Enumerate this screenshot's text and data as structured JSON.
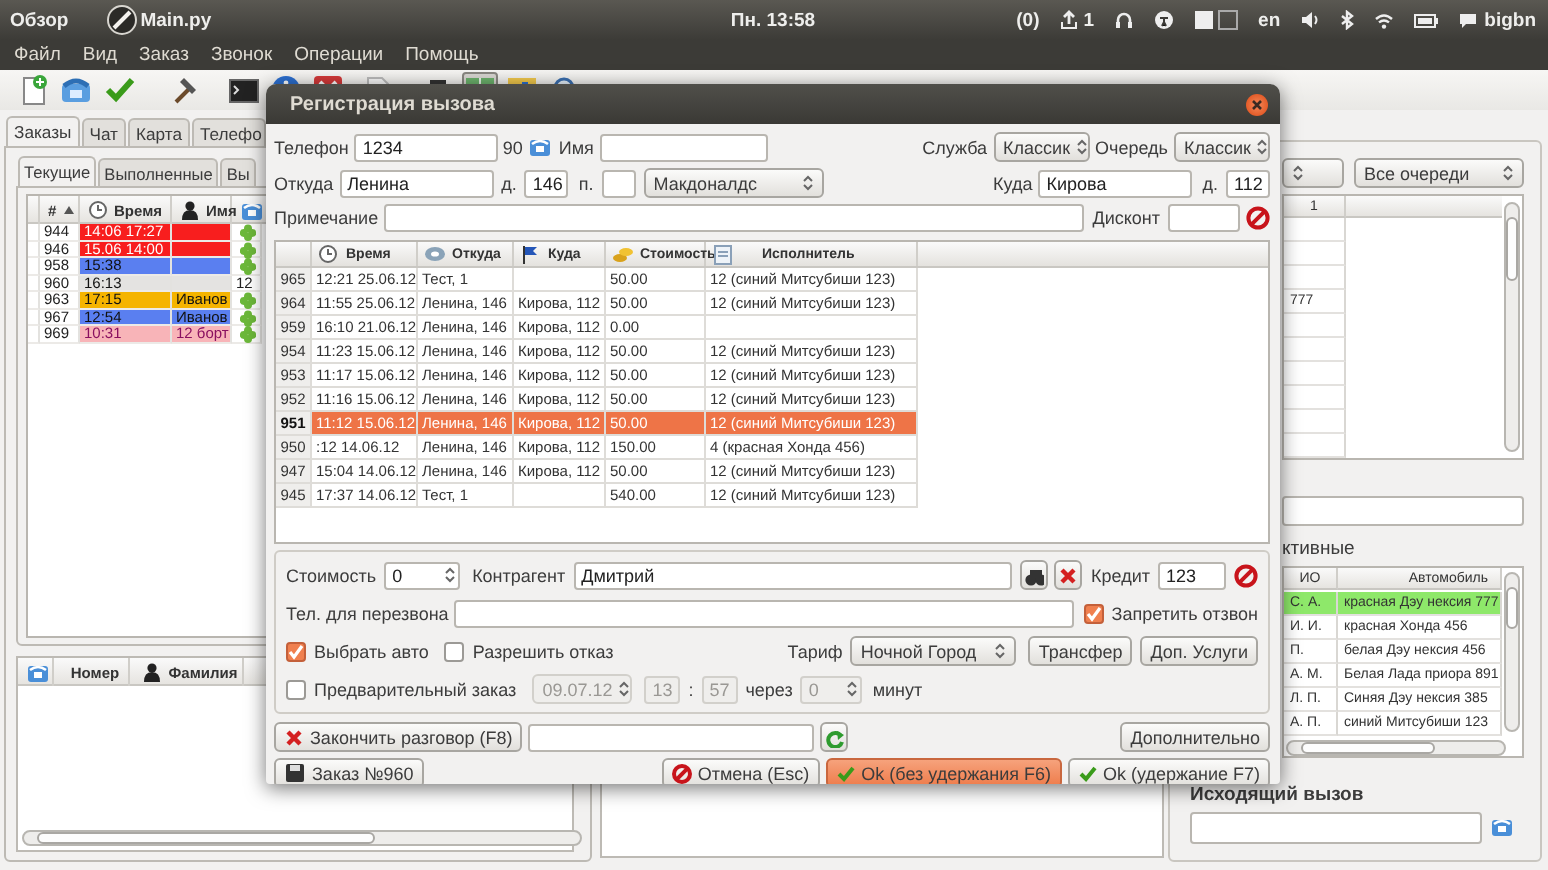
{
  "top_panel": {
    "activities": "Обзор",
    "window_title": "Main.py",
    "clock": "Пн. 13:58",
    "messages": "(0)",
    "updates": "1",
    "keyboard": "en",
    "user": "bigbn"
  },
  "menu": [
    "Файл",
    "Вид",
    "Заказ",
    "Звонок",
    "Операции",
    "Помощь"
  ],
  "toolbar": [
    {
      "selected": false
    },
    {
      "selected": false
    },
    {
      "selected": false
    },
    {
      "selected": false
    },
    {
      "selected": false
    },
    {
      "selected": false
    },
    {
      "selected": false
    },
    {
      "selected": false
    },
    {
      "selected": false
    },
    {
      "selected": true
    },
    {
      "selected": false
    },
    {
      "selected": false
    }
  ],
  "left_panel": {
    "tabs": [
      {
        "label": "Заказы",
        "selected": true
      },
      {
        "label": "Чат",
        "selected": false
      },
      {
        "label": "Карта",
        "selected": false
      },
      {
        "label": "Телефо",
        "selected": false
      }
    ],
    "subtabs": [
      {
        "label": "Текущие",
        "selected": true
      },
      {
        "label": "Выполненные",
        "selected": false
      },
      {
        "label": "Вы",
        "selected": false
      }
    ],
    "orders": {
      "columns": [
        "#",
        "Время",
        "Имя"
      ],
      "rows": [
        {
          "number": "944",
          "time": "14:06 17:27",
          "color": "#f81e1e"
        },
        {
          "number": "946",
          "time": "15.06 14:00",
          "color": "#f81e1e"
        },
        {
          "number": "958",
          "time": "15:38",
          "color": "#5a7ff0"
        },
        {
          "number": "960",
          "time": "16:13",
          "column_4": "12",
          "color": "#e4e3e1"
        },
        {
          "number": "963",
          "time": "17:15",
          "name": "Иванов",
          "color": "#f5b400"
        },
        {
          "number": "967",
          "time": "12:54",
          "name": "Иванов",
          "color": "#5a7ff0"
        },
        {
          "number": "969",
          "time": "10:31",
          "name": "12 борт",
          "color": "#f8b4b8"
        }
      ]
    },
    "calls": {
      "columns": [
        "Номер",
        "Фамилия"
      ]
    }
  },
  "right_panel": {
    "queue_filter": "Все очереди",
    "queue_table": {
      "columns": [
        "1"
      ],
      "rows": [
        {},
        {},
        {},
        {
          "column_1": "777"
        },
        {},
        {},
        {},
        {},
        {},
        {}
      ]
    },
    "drivers_title": "ктивные",
    "drivers": {
      "columns": [
        "ИО",
        "Автомобиль"
      ],
      "rows": [
        {
          "name": "С. А.",
          "car": "красная Дэу нексия 777",
          "selected": true
        },
        {
          "name": "И. И.",
          "car": "красная Хонда 456",
          "selected": false
        },
        {
          "name": "П.",
          "car": "белая Дэу нексия 456",
          "selected": false
        },
        {
          "name": "А. М.",
          "car": "Белая Лада приора 891",
          "selected": false
        },
        {
          "name": "Л. П.",
          "car": "Синяя Дэу нексия 385",
          "selected": false
        },
        {
          "name": "А. П.",
          "car": "синий Митсубиши 123",
          "selected": false
        }
      ]
    },
    "outgoing_title": "Исходящий вызов"
  },
  "dialog": {
    "title": "Регистрация вызова",
    "phone_label": "Телефон",
    "phone": "1234",
    "phone_suffix": "90",
    "name_label": "Имя",
    "service_label": "Служба",
    "service": "Классик",
    "queue_label": "Очередь",
    "queue": "Классик",
    "from_label": "Откуда",
    "from_street": "Ленина",
    "from_house_label": "д.",
    "from_house": "146",
    "entrance_label": "п.",
    "place": "Макдоналдс",
    "to_label": "Куда",
    "to_street": "Кирова",
    "to_house_label": "д.",
    "to_house": "112",
    "note_label": "Примечание",
    "discount_label": "Дисконт",
    "history": {
      "columns": [
        "Время",
        "Откуда",
        "Куда",
        "Стоимость",
        "Исполнитель"
      ],
      "rows": [
        {
          "id": "965",
          "time": "12:21 25.06.12",
          "from": "Тест, 1",
          "cost": "50.00",
          "driver": "12 (синий Митсубиши 123)",
          "selected": false
        },
        {
          "id": "964",
          "time": "11:55 25.06.12",
          "from": "Ленина, 146",
          "to": "Кирова, 112",
          "cost": "50.00",
          "driver": "12 (синий Митсубиши 123)",
          "selected": false
        },
        {
          "id": "959",
          "time": "16:10 21.06.12",
          "from": "Ленина, 146",
          "to": "Кирова, 112",
          "cost": "0.00",
          "selected": false
        },
        {
          "id": "954",
          "time": "11:23 15.06.12",
          "from": "Ленина, 146",
          "to": "Кирова, 112",
          "cost": "50.00",
          "driver": "12 (синий Митсубиши 123)",
          "selected": false
        },
        {
          "id": "953",
          "time": "11:17 15.06.12",
          "from": "Ленина, 146",
          "to": "Кирова, 112",
          "cost": "50.00",
          "driver": "12 (синий Митсубиши 123)",
          "selected": false
        },
        {
          "id": "952",
          "time": "11:16 15.06.12",
          "from": "Ленина, 146",
          "to": "Кирова, 112",
          "cost": "50.00",
          "driver": "12 (синий Митсубиши 123)",
          "selected": false
        },
        {
          "id": "951",
          "time": "11:12 15.06.12",
          "from": "Ленина, 146",
          "to": "Кирова, 112",
          "cost": "50.00",
          "driver": "12 (синий Митсубиши 123)",
          "selected": true
        },
        {
          "id": "950",
          "time": ":12 14.06.12",
          "from": "Ленина, 146",
          "to": "Кирова, 112",
          "cost": "150.00",
          "driver": "4 (красная Хонда 456)",
          "selected": false
        },
        {
          "id": "947",
          "time": "15:04 14.06.12",
          "from": "Ленина, 146",
          "to": "Кирова, 112",
          "cost": "50.00",
          "driver": "12 (синий Митсубиши 123)",
          "selected": false
        },
        {
          "id": "945",
          "time": "17:37 14.06.12",
          "from": "Тест, 1",
          "cost": "540.00",
          "driver": "12 (синий Митсубиши 123)",
          "selected": false
        }
      ]
    },
    "cost_label": "Стоимость",
    "cost": "0",
    "contractor_label": "Контрагент",
    "contractor": "Дмитрий",
    "credit_label": "Кредит",
    "credit": "123",
    "callback_label": "Тел. для перезвона",
    "no_callback": {
      "label": "Запретить отзвон",
      "checked": true
    },
    "choose_car": {
      "label": "Выбрать авто",
      "checked": true
    },
    "allow_refusal": {
      "label": "Разрешить отказ",
      "checked": false
    },
    "tariff_label": "Тариф",
    "tariff": "Ночной Город",
    "transfer": "Трансфер",
    "extras": "Доп. Услуги",
    "preorder": {
      "label": "Предварительный заказ",
      "checked": false,
      "date": "09.07.12",
      "hour": "13",
      "separator": ":",
      "minute": "57",
      "in_label": "через",
      "in_value": "0",
      "unit": "минут"
    },
    "end_call": "Закончить разговор (F8)",
    "more": "Дополнительно",
    "order": "Заказ №960",
    "actions": [
      {
        "label": "Отмена (Esc)",
        "kind": "cancel",
        "highlighted": false
      },
      {
        "label": "Ok (без удержания F6)",
        "kind": "ok",
        "highlighted": true
      },
      {
        "label": "Ok (удержание F7)",
        "kind": "ok",
        "highlighted": false
      }
    ]
  }
}
